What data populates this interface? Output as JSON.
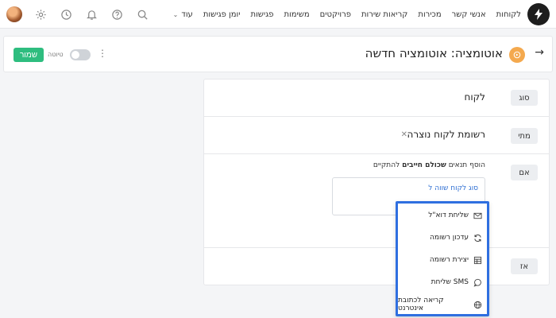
{
  "nav": {
    "links": [
      "לקוחות",
      "אנשי קשר",
      "מכירות",
      "קריאות שירות",
      "פרויקטים",
      "משימות",
      "פגישות",
      "יומן פגישות"
    ],
    "more": "עוד"
  },
  "header": {
    "title": "אוטומציה: אוטומציה חדשה",
    "draft_label": "טיוטה",
    "save_label": "שמור"
  },
  "rules": {
    "type": {
      "label": "סוג",
      "value": "לקוח"
    },
    "when": {
      "label": "מתי",
      "value": "רשומת לקוח נוצרה"
    },
    "if": {
      "label": "אם",
      "instruction_pre": "הוסף תנאים",
      "instruction_bold": "שכולם חייבים",
      "instruction_post": "להתקיים",
      "condition_link": "סוג לקוח שווה ל"
    },
    "then": {
      "label": "אז"
    }
  },
  "dropdown": {
    "items": [
      {
        "label": "שליחת דוא\"ל",
        "icon": "envelope-icon"
      },
      {
        "label": "עדכון רשומה",
        "icon": "refresh-icon"
      },
      {
        "label": "יצירת רשומה",
        "icon": "table-icon"
      },
      {
        "label": "שליחת SMS",
        "icon": "chat-bubble-icon"
      },
      {
        "label": "קריאה לכתובת אינטרנט",
        "icon": "globe-icon"
      }
    ]
  },
  "colors": {
    "accent": "#2ebd7f",
    "link": "#2f6fd3",
    "highlight": "#2f6fe0",
    "automation_icon": "#f4a94e"
  }
}
